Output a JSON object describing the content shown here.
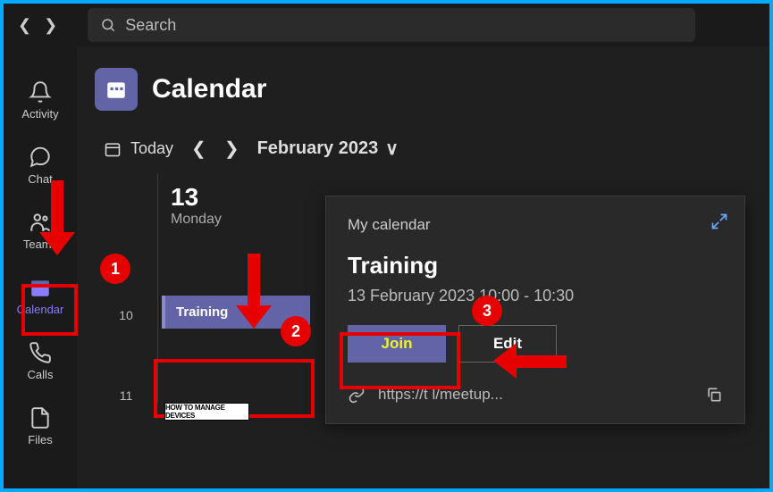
{
  "topbar": {
    "search_placeholder": "Search"
  },
  "sidebar": {
    "items": [
      {
        "label": "Activity"
      },
      {
        "label": "Chat"
      },
      {
        "label": "Teams"
      },
      {
        "label": "Calendar"
      },
      {
        "label": "Calls"
      },
      {
        "label": "Files"
      }
    ]
  },
  "header": {
    "title": "Calendar"
  },
  "datenav": {
    "today": "Today",
    "month": "February 2023"
  },
  "day": {
    "number": "13",
    "name": "Monday"
  },
  "timeline": {
    "hour_10": "10",
    "hour_11": "11"
  },
  "event": {
    "title": "Training"
  },
  "popover": {
    "label": "My calendar",
    "title": "Training",
    "datetime": "13 February 2023 10:00 - 10:30",
    "join": "Join",
    "edit": "Edit",
    "url": "https://t                                    l/meetup..."
  },
  "annotations": {
    "n1": "1",
    "n2": "2",
    "n3": "3"
  },
  "watermark": "HOW TO MANAGE DEVICES"
}
